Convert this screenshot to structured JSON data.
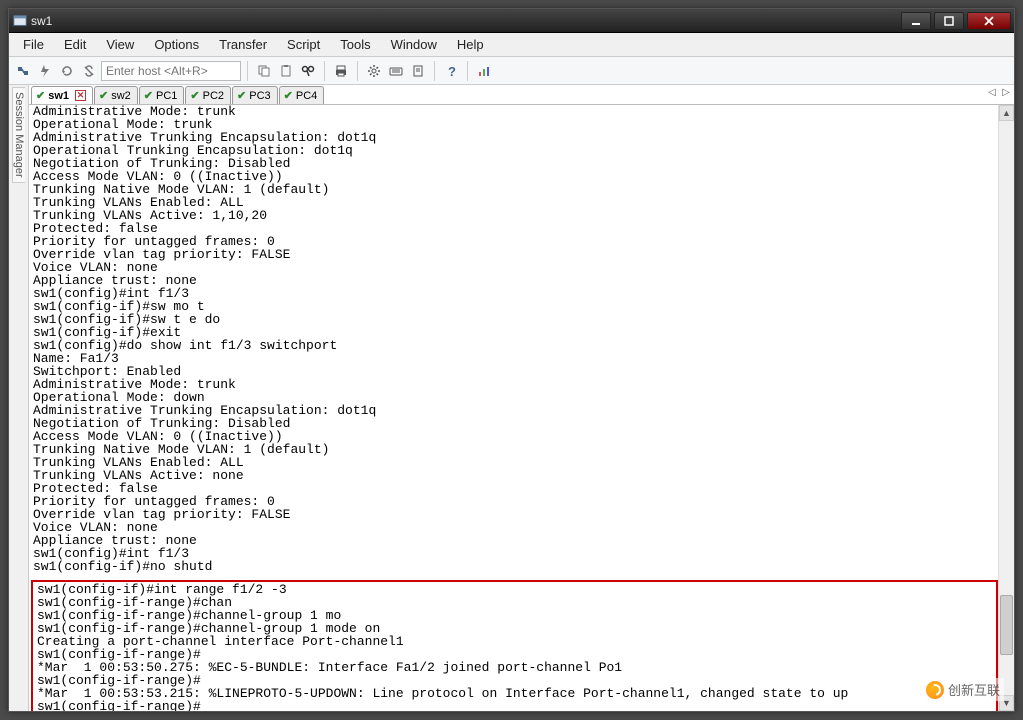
{
  "window": {
    "title": "sw1"
  },
  "menu": {
    "items": [
      "File",
      "Edit",
      "View",
      "Options",
      "Transfer",
      "Script",
      "Tools",
      "Window",
      "Help"
    ]
  },
  "toolbar": {
    "host_placeholder": "Enter host <Alt+R>"
  },
  "leftbar": {
    "label": "Session Manager"
  },
  "tabs": [
    {
      "label": "sw1",
      "active": true,
      "closeable": true
    },
    {
      "label": "sw2",
      "active": false,
      "closeable": false
    },
    {
      "label": "PC1",
      "active": false,
      "closeable": false
    },
    {
      "label": "PC2",
      "active": false,
      "closeable": false
    },
    {
      "label": "PC3",
      "active": false,
      "closeable": false
    },
    {
      "label": "PC4",
      "active": false,
      "closeable": false
    }
  ],
  "terminal": {
    "upper": "Administrative Mode: trunk\nOperational Mode: trunk\nAdministrative Trunking Encapsulation: dot1q\nOperational Trunking Encapsulation: dot1q\nNegotiation of Trunking: Disabled\nAccess Mode VLAN: 0 ((Inactive))\nTrunking Native Mode VLAN: 1 (default)\nTrunking VLANs Enabled: ALL\nTrunking VLANs Active: 1,10,20\nProtected: false\nPriority for untagged frames: 0\nOverride vlan tag priority: FALSE\nVoice VLAN: none\nAppliance trust: none\nsw1(config)#int f1/3\nsw1(config-if)#sw mo t\nsw1(config-if)#sw t e do\nsw1(config-if)#exit\nsw1(config)#do show int f1/3 switchport\nName: Fa1/3\nSwitchport: Enabled\nAdministrative Mode: trunk\nOperational Mode: down\nAdministrative Trunking Encapsulation: dot1q\nNegotiation of Trunking: Disabled\nAccess Mode VLAN: 0 ((Inactive))\nTrunking Native Mode VLAN: 1 (default)\nTrunking VLANs Enabled: ALL\nTrunking VLANs Active: none\nProtected: false\nPriority for untagged frames: 0\nOverride vlan tag priority: FALSE\nVoice VLAN: none\nAppliance trust: none\nsw1(config)#int f1/3\nsw1(config-if)#no shutd",
    "boxed": "sw1(config-if)#int range f1/2 -3\nsw1(config-if-range)#chan\nsw1(config-if-range)#channel-group 1 mo\nsw1(config-if-range)#channel-group 1 mode on\nCreating a port-channel interface Port-channel1\nsw1(config-if-range)#\n*Mar  1 00:53:50.275: %EC-5-BUNDLE: Interface Fa1/2 joined port-channel Po1\nsw1(config-if-range)#\n*Mar  1 00:53:53.215: %LINEPROTO-5-UPDOWN: Line protocol on Interface Port-channel1, changed state to up\nsw1(config-if-range)#"
  },
  "watermark": {
    "text": "创新互联"
  }
}
